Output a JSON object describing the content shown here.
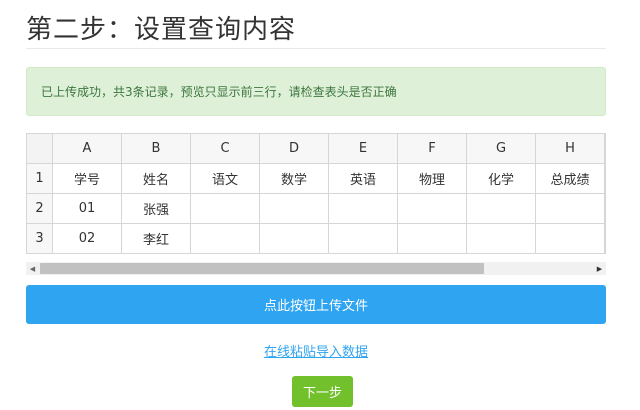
{
  "page": {
    "title": "第二步：设置查询内容"
  },
  "alert": {
    "message": "已上传成功，共3条记录，预览只显示前三行，请检查表头是否正确"
  },
  "sheet": {
    "columns": [
      "A",
      "B",
      "C",
      "D",
      "E",
      "F",
      "G",
      "H"
    ],
    "rows": [
      {
        "num": "1",
        "cells": [
          "学号",
          "姓名",
          "语文",
          "数学",
          "英语",
          "物理",
          "化学",
          "总成绩"
        ]
      },
      {
        "num": "2",
        "cells": [
          "01",
          "张强",
          "",
          "",
          "",
          "",
          "",
          ""
        ]
      },
      {
        "num": "3",
        "cells": [
          "02",
          "李红",
          "",
          "",
          "",
          "",
          "",
          ""
        ]
      }
    ]
  },
  "actions": {
    "upload_label": "点此按钮上传文件",
    "paste_link_label": "在线粘贴导入数据",
    "next_label": "下一步"
  },
  "colors": {
    "primary": "#2fa4f0",
    "success": "#72c02c",
    "alert_bg": "#dff0d8",
    "alert_text": "#3c763d"
  }
}
